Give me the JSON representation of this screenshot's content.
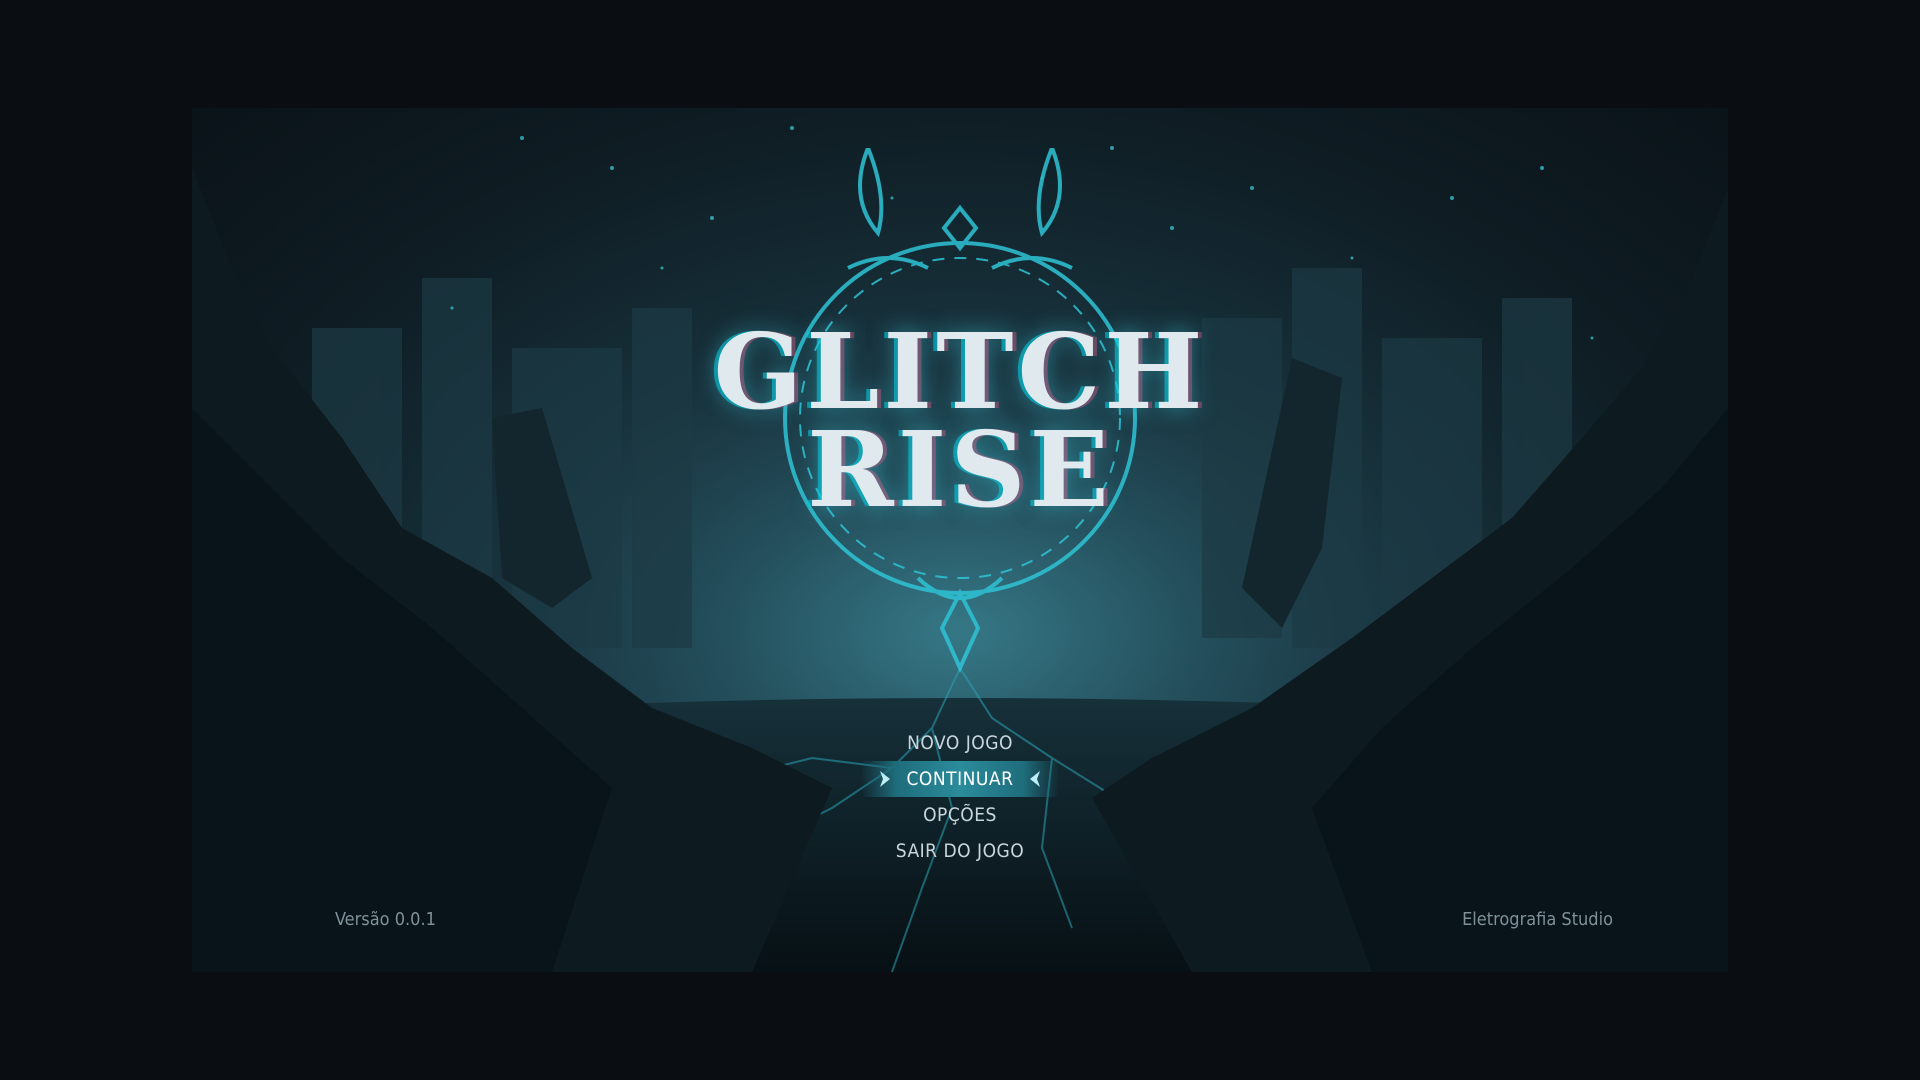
{
  "game": {
    "title_line_1": "GLITCH",
    "title_line_2": "RISE"
  },
  "menu": {
    "items": [
      {
        "label": "NOVO JOGO",
        "selected": false
      },
      {
        "label": "CONTINUAR",
        "selected": true
      },
      {
        "label": "OPÇÕES",
        "selected": false
      },
      {
        "label": "SAIR DO JOGO",
        "selected": false
      }
    ]
  },
  "footer": {
    "version": "Versão 0.0.1",
    "studio": "Eletrografia Studio"
  },
  "colors": {
    "background": "#0a0e13",
    "accent": "#2ec4d6",
    "selection": "#2a8c9b",
    "text": "#c9d6dc"
  },
  "icons": {
    "selection_left": "chevron-right-icon",
    "selection_right": "chevron-left-icon"
  }
}
